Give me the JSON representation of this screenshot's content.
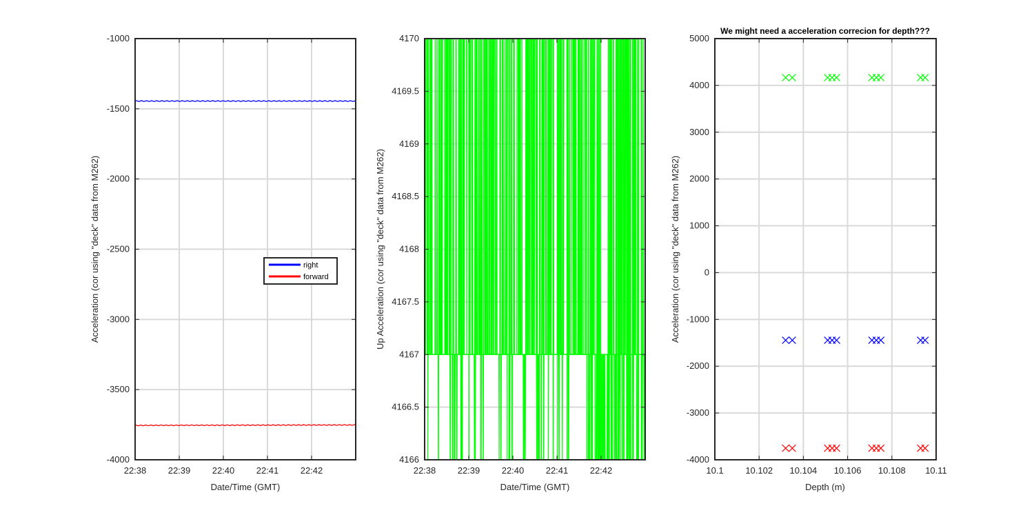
{
  "chart_data": [
    {
      "type": "line",
      "title": "",
      "xlabel": "Date/Time (GMT)",
      "ylabel": "Acceleration (cor using \"deck\" data from M262)",
      "x_ticks": [
        "22:38",
        "22:39",
        "22:40",
        "22:41",
        "22:42"
      ],
      "x_range": [
        "22:38",
        "22:43"
      ],
      "ylim": [
        -4000,
        -1000
      ],
      "y_ticks": [
        "-1000",
        "-1500",
        "-2000",
        "-2500",
        "-3000",
        "-3500",
        "-4000"
      ],
      "grid": true,
      "legend_position": "center-right",
      "series": [
        {
          "name": "right",
          "color": "#0000ff",
          "x": [
            "22:38",
            "22:43"
          ],
          "values": [
            -1445,
            -1445
          ]
        },
        {
          "name": "forward",
          "color": "#ff0000",
          "x": [
            "22:38",
            "22:43"
          ],
          "values": [
            -3755,
            -3752
          ]
        }
      ]
    },
    {
      "type": "line",
      "title": "",
      "xlabel": "Date/Time (GMT)",
      "ylabel": "Up Acceleration (cor using \"deck\" data from M262)",
      "x_ticks": [
        "22:38",
        "22:39",
        "22:40",
        "22:41",
        "22:42"
      ],
      "x_range": [
        "22:38",
        "22:43"
      ],
      "ylim": [
        4166,
        4170
      ],
      "y_ticks": [
        "4170",
        "4169.5",
        "4169",
        "4168.5",
        "4168",
        "4167.5",
        "4167",
        "4166.5",
        "4166"
      ],
      "grid": true,
      "series": [
        {
          "color": "#00ff00",
          "levels": [
            4166,
            4167,
            4170
          ],
          "description_range": [
            4166,
            4170
          ]
        }
      ]
    },
    {
      "type": "scatter",
      "title": "We might need a acceleration correcion for depth???",
      "xlabel": "Depth (m)",
      "ylabel": "Acceleration (cor using \"deck\" data from M262)",
      "xlim": [
        10.1,
        10.11
      ],
      "x_ticks": [
        "10.1",
        "10.102",
        "10.104",
        "10.106",
        "10.108",
        "10.11"
      ],
      "ylim": [
        -4000,
        5000
      ],
      "y_ticks": [
        "5000",
        "4000",
        "3000",
        "2000",
        "1000",
        "0",
        "-1000",
        "-2000",
        "-3000",
        "-4000"
      ],
      "grid": true,
      "marker": "x",
      "x": [
        10.1032,
        10.1035,
        10.1051,
        10.1053,
        10.1055,
        10.1071,
        10.1073,
        10.1075,
        10.1093,
        10.1095
      ],
      "series": [
        {
          "color": "#00ff00",
          "values": [
            4167,
            4167,
            4167,
            4167,
            4167,
            4167,
            4167,
            4167,
            4167,
            4167
          ]
        },
        {
          "color": "#0000ff",
          "values": [
            -1445,
            -1445,
            -1445,
            -1445,
            -1445,
            -1445,
            -1445,
            -1445,
            -1445,
            -1445
          ]
        },
        {
          "color": "#ff0000",
          "values": [
            -3753,
            -3753,
            -3753,
            -3753,
            -3753,
            -3753,
            -3753,
            -3753,
            -3753,
            -3753
          ]
        }
      ]
    }
  ]
}
